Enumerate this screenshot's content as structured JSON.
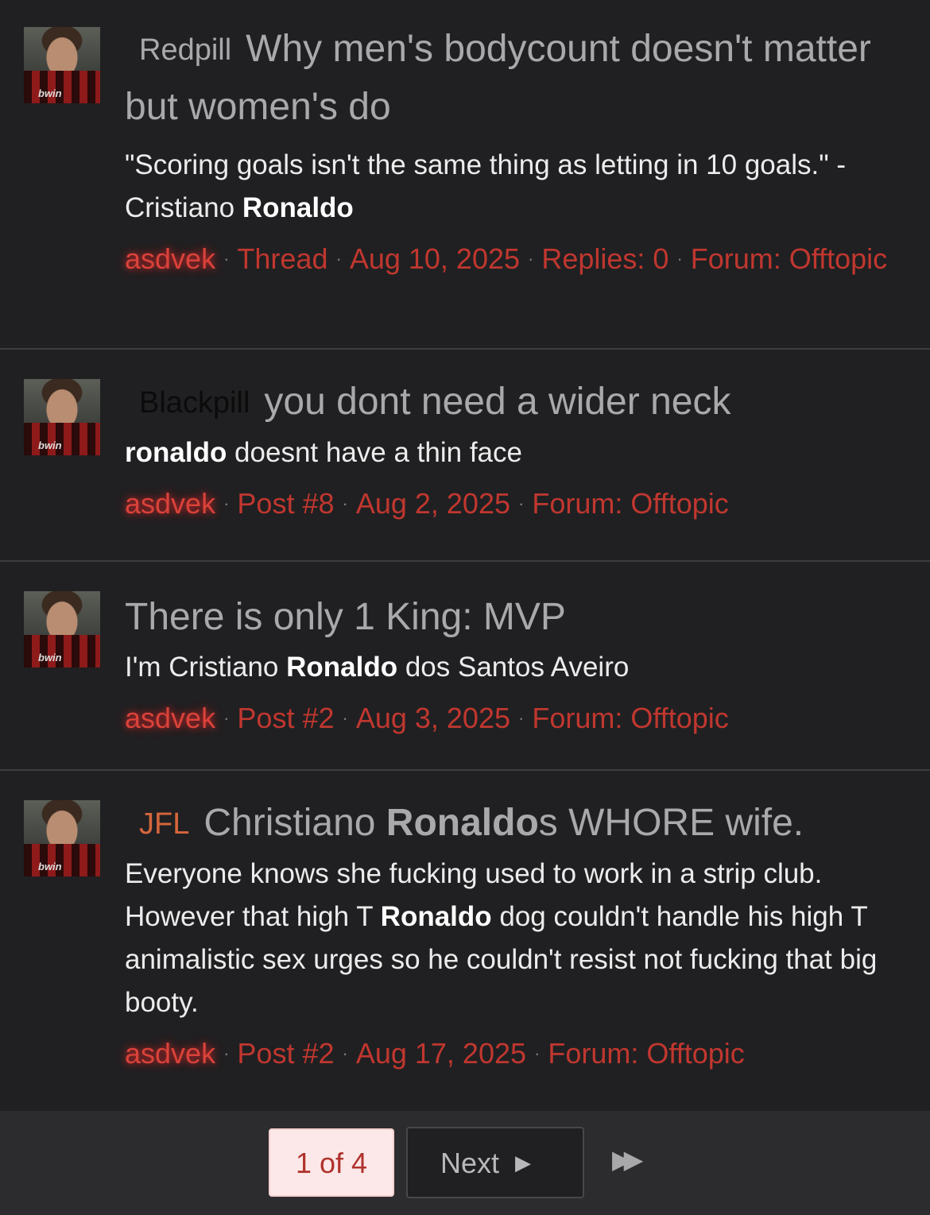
{
  "results": [
    {
      "prefix": "Redpill",
      "title_parts": [
        "Why men's bodycount doesn't matter but women's do",
        "",
        ""
      ],
      "snippet_before": "\"Scoring goals isn't the same thing as letting in 10 goals.\" -Cristiano ",
      "snippet_bold": "Ronaldo",
      "snippet_after": "",
      "snippet_bold2": "",
      "snippet_after2": "",
      "author": "asdvek",
      "type": "Thread",
      "date": "Aug 10, 2025",
      "replies": "Replies: 0",
      "forum": "Forum: Offtopic"
    },
    {
      "prefix": "Blackpill",
      "title_parts": [
        "you dont need a wider neck",
        "",
        ""
      ],
      "snippet_before": "",
      "snippet_bold": "ronaldo",
      "snippet_after": " doesnt have a thin face",
      "author": "asdvek",
      "type": "Post #8",
      "date": "Aug 2, 2025",
      "forum": "Forum: Offtopic"
    },
    {
      "prefix": "",
      "title_parts": [
        "There is only 1 King: MVP",
        "",
        ""
      ],
      "snippet_before": "I'm Cristiano ",
      "snippet_bold": "Ronaldo",
      "snippet_after": " dos Santos Aveiro",
      "author": "asdvek",
      "type": "Post #2",
      "date": "Aug 3, 2025",
      "forum": "Forum: Offtopic"
    },
    {
      "prefix": "JFL",
      "title_parts": [
        "Christiano ",
        "Ronaldo",
        "s WHORE wife."
      ],
      "snippet_before": "Everyone knows she fucking used to work in a strip club. However that high T ",
      "snippet_bold": "Ronaldo",
      "snippet_after": " dog couldn't handle his high T animalistic sex urges so he couldn't resist not fucking that big booty.",
      "author": "asdvek",
      "type": "Post #2",
      "date": "Aug 17, 2025",
      "forum": "Forum: Offtopic"
    }
  ],
  "avatar_text": "bwin",
  "pagination": {
    "current": "1 of 4",
    "next_label": "Next",
    "next_icon": "caret-right-icon",
    "last_icon": "fast-forward-icon"
  },
  "colors": {
    "background": "#202022",
    "meta_red": "#c0372f",
    "jfl_prefix": "#d4663c",
    "page_current_bg": "#fce8e8"
  }
}
